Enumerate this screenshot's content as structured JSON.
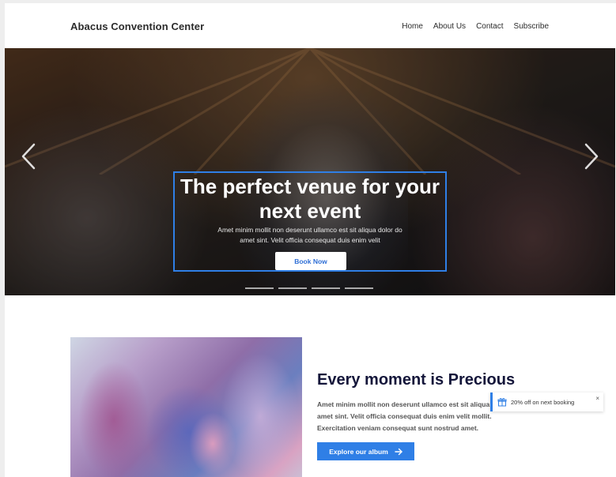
{
  "header": {
    "brand": "Abacus Convention Center",
    "nav": [
      "Home",
      "About Us",
      "Contact",
      "Subscribe"
    ]
  },
  "hero": {
    "title": "The perfect venue for your next event",
    "text": "Amet minim mollit non deserunt ullamco est sit aliqua dolor do amet sint. Velit officia consequat duis enim velit",
    "button": "Book Now",
    "slides": 4,
    "prev_icon": "chevron-left-icon",
    "next_icon": "chevron-right-icon"
  },
  "feature": {
    "title": "Every moment is Precious",
    "text": "Amet minim mollit non deserunt ullamco est sit aliqua dolor do amet sint. Velit officia consequat duis enim velit mollit. Exercitation veniam consequat sunt nostrud amet.",
    "button": "Explore our album",
    "button_icon": "arrow-right-icon"
  },
  "toast": {
    "message": "20% off on next booking",
    "icon": "gift-icon",
    "close": "×"
  },
  "colors": {
    "accent": "#2f7fe6",
    "heading": "#14163a"
  }
}
